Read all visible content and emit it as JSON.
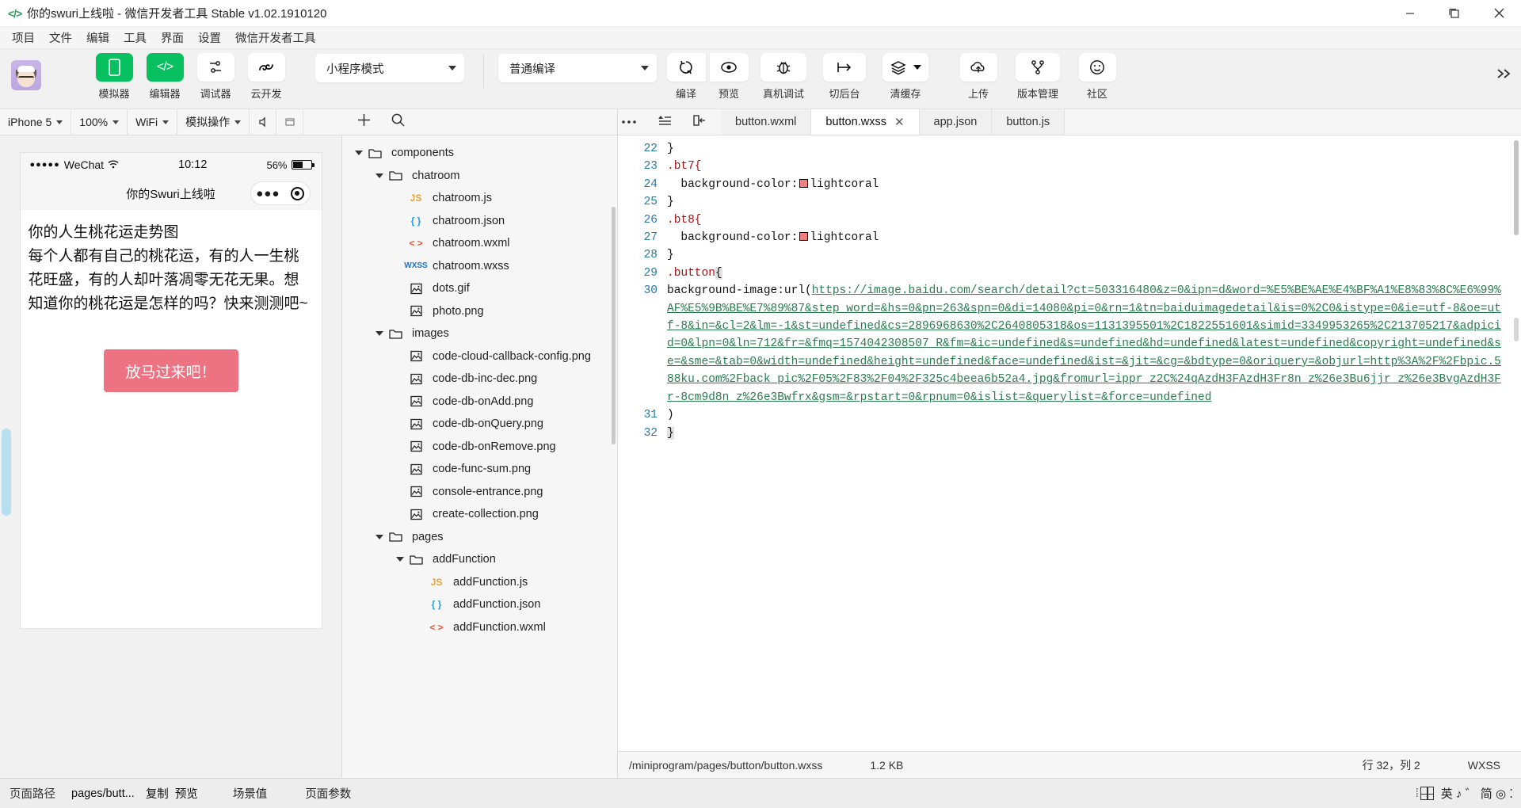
{
  "titlebar": {
    "logo_icon": "code-brackets-icon",
    "title": "你的swuri上线啦 - 微信开发者工具 Stable v1.02.1910120",
    "minimize": "minimize-icon",
    "maximize": "maximize-icon",
    "close": "close-icon"
  },
  "menubar": {
    "items": [
      "项目",
      "文件",
      "编辑",
      "工具",
      "界面",
      "设置",
      "微信开发者工具"
    ]
  },
  "toolbar": {
    "buttons": [
      {
        "label": "模拟器",
        "icon": "phone-icon",
        "style": "green"
      },
      {
        "label": "编辑器",
        "icon": "code-icon",
        "style": "green"
      },
      {
        "label": "调试器",
        "icon": "debugger-icon",
        "style": "white"
      },
      {
        "label": "云开发",
        "icon": "cloud-dev-icon",
        "style": "white"
      }
    ],
    "mode_select": "小程序模式",
    "compile_select": "普通编译",
    "actions": [
      {
        "label": "编译",
        "icon": "refresh-icon"
      },
      {
        "label": "预览",
        "icon": "eye-icon"
      },
      {
        "label": "真机调试",
        "icon": "bug-icon"
      },
      {
        "label": "切后台",
        "icon": "background-icon"
      },
      {
        "label": "清缓存",
        "icon": "layers-icon",
        "has_caret": true
      },
      {
        "label": "上传",
        "icon": "cloud-upload-icon"
      },
      {
        "label": "版本管理",
        "icon": "branch-icon"
      },
      {
        "label": "社区",
        "icon": "smiley-icon"
      }
    ],
    "overflow_icon": "chevron-right-double-icon"
  },
  "device_bar": {
    "device": "iPhone 5",
    "zoom": "100%",
    "network": "WiFi",
    "simulate": "模拟操作",
    "mute_icon": "volume-icon",
    "window_icon": "window-icon"
  },
  "tree_bar": {
    "add_icon": "plus-icon",
    "search_icon": "search-icon"
  },
  "editor_bar": {
    "more_icon": "ellipsis-icon",
    "outline_icon": "outline-icon",
    "split_icon": "split-panel-icon",
    "tabs": [
      {
        "label": "button.wxml",
        "active": false,
        "closable": false
      },
      {
        "label": "button.wxss",
        "active": true,
        "closable": true,
        "close_icon": "close-icon"
      },
      {
        "label": "app.json",
        "active": false,
        "closable": false
      },
      {
        "label": "button.js",
        "active": false,
        "closable": false
      }
    ]
  },
  "simulator": {
    "status": {
      "carrier_dots": "●●●●●",
      "carrier": "WeChat",
      "wifi_icon": "wifi-icon",
      "time": "10:12",
      "battery_percent": "56%",
      "battery_icon": "battery-icon"
    },
    "nav_title": "你的Swuri上线啦",
    "capsule": {
      "menu_icon": "ellipsis-icon",
      "close_icon": "target-circle-icon"
    },
    "page": {
      "heading": "你的人生桃花运走势图",
      "paragraph": "每个人都有自己的桃花运，有的人一生桃花旺盛，有的人却叶落凋零无花无果。想知道你的桃花运是怎样的吗？快来测测吧~",
      "cta": "放马过来吧！",
      "cta_color": "#ee7382"
    }
  },
  "file_tree": {
    "items": [
      {
        "label": "components",
        "type": "folder",
        "depth": 0,
        "open": true
      },
      {
        "label": "chatroom",
        "type": "folder",
        "depth": 1,
        "open": true
      },
      {
        "label": "chatroom.js",
        "type": "js",
        "depth": 2
      },
      {
        "label": "chatroom.json",
        "type": "json",
        "depth": 2
      },
      {
        "label": "chatroom.wxml",
        "type": "wxml",
        "depth": 2
      },
      {
        "label": "chatroom.wxss",
        "type": "wxss",
        "depth": 2
      },
      {
        "label": "dots.gif",
        "type": "image",
        "depth": 2
      },
      {
        "label": "photo.png",
        "type": "image",
        "depth": 2
      },
      {
        "label": "images",
        "type": "folder",
        "depth": 1,
        "open": true
      },
      {
        "label": "code-cloud-callback-config.png",
        "type": "image",
        "depth": 2
      },
      {
        "label": "code-db-inc-dec.png",
        "type": "image",
        "depth": 2
      },
      {
        "label": "code-db-onAdd.png",
        "type": "image",
        "depth": 2
      },
      {
        "label": "code-db-onQuery.png",
        "type": "image",
        "depth": 2
      },
      {
        "label": "code-db-onRemove.png",
        "type": "image",
        "depth": 2
      },
      {
        "label": "code-func-sum.png",
        "type": "image",
        "depth": 2
      },
      {
        "label": "console-entrance.png",
        "type": "image",
        "depth": 2
      },
      {
        "label": "create-collection.png",
        "type": "image",
        "depth": 2
      },
      {
        "label": "pages",
        "type": "folder",
        "depth": 1,
        "open": true
      },
      {
        "label": "addFunction",
        "type": "folder",
        "depth": 2,
        "open": true
      },
      {
        "label": "addFunction.js",
        "type": "js",
        "depth": 3
      },
      {
        "label": "addFunction.json",
        "type": "json",
        "depth": 3
      },
      {
        "label": "addFunction.wxml",
        "type": "wxml",
        "depth": 3
      }
    ]
  },
  "code": {
    "first_line_number": 22,
    "lines": [
      {
        "n": 22,
        "parts": [
          {
            "t": "}",
            "c": "plain"
          }
        ]
      },
      {
        "n": 23,
        "parts": [
          {
            "t": ".bt7{",
            "c": "sel"
          }
        ]
      },
      {
        "n": 24,
        "parts": [
          {
            "t": "  background-color:",
            "c": "plain"
          },
          {
            "t": "swatch",
            "c": "swatch"
          },
          {
            "t": "lightcoral",
            "c": "plain"
          }
        ]
      },
      {
        "n": 25,
        "parts": [
          {
            "t": "}",
            "c": "plain"
          }
        ]
      },
      {
        "n": 26,
        "parts": [
          {
            "t": ".bt8{",
            "c": "sel"
          }
        ]
      },
      {
        "n": 27,
        "parts": [
          {
            "t": "  background-color:",
            "c": "plain"
          },
          {
            "t": "swatch",
            "c": "swatch"
          },
          {
            "t": "lightcoral",
            "c": "plain"
          }
        ]
      },
      {
        "n": 28,
        "parts": [
          {
            "t": "}",
            "c": "plain"
          }
        ]
      },
      {
        "n": 29,
        "parts": [
          {
            "t": ".button",
            "c": "sel"
          },
          {
            "t": "{",
            "c": "brace"
          }
        ]
      },
      {
        "n": 30,
        "parts": [
          {
            "t": "background-image:url(",
            "c": "plain"
          },
          {
            "t": "https://image.baidu.com/search/detail?ct=503316480&z=0&ipn=d&word=%E5%BE%AE%E4%BF%A1%E8%83%8C%E6%99%AF%E5%9B%BE%E7%89%87&step_word=&hs=0&pn=263&spn=0&di=14080&pi=0&rn=1&tn=baiduimagedetail&is=0%2C0&istype=0&ie=utf-8&oe=utf-8&in=&cl=2&lm=-1&st=undefined&cs=2896968630%2C2640805318&os=1131395501%2C1822551601&simid=3349953265%2C213705217&adpicid=0&lpn=0&ln=712&fr=&fmq=1574042308507_R&fm=&ic=undefined&s=undefined&hd=undefined&latest=undefined&copyright=undefined&se=&sme=&tab=0&width=undefined&height=undefined&face=undefined&ist=&jit=&cg=&bdtype=0&oriquery=&objurl=http%3A%2F%2Fbpic.588ku.com%2Fback_pic%2F05%2F83%2F04%2F325c4beea6b52a4.jpg&fromurl=ippr_z2C%24qAzdH3FAzdH3Fr8n_z%26e3Bu6jjr_z%26e3BvgAzdH3Fr-8cm9d8n_z%26e3Bwfrx&gsm=&rpstart=0&rpnum=0&islist=&querylist=&force=undefined",
            "c": "url"
          }
        ]
      },
      {
        "n": 31,
        "parts": [
          {
            "t": ")",
            "c": "plain"
          }
        ]
      },
      {
        "n": 32,
        "parts": [
          {
            "t": "}",
            "c": "brace"
          }
        ]
      }
    ],
    "swatch_color": "#f08080"
  },
  "status_line": {
    "path": "/miniprogram/pages/button/button.wxss",
    "size": "1.2 KB",
    "position": "行 32，列 2",
    "language": "WXSS"
  },
  "bottom_bar": {
    "label": "页面路径",
    "path": "pages/butt...",
    "copy": "复制",
    "preview": "预览",
    "scene": "场景值",
    "params": "页面参数",
    "ime": {
      "grid_icon": "ime-grid-icon",
      "text": "英 ♪ ゛ 简 ◎ ⁚"
    }
  }
}
